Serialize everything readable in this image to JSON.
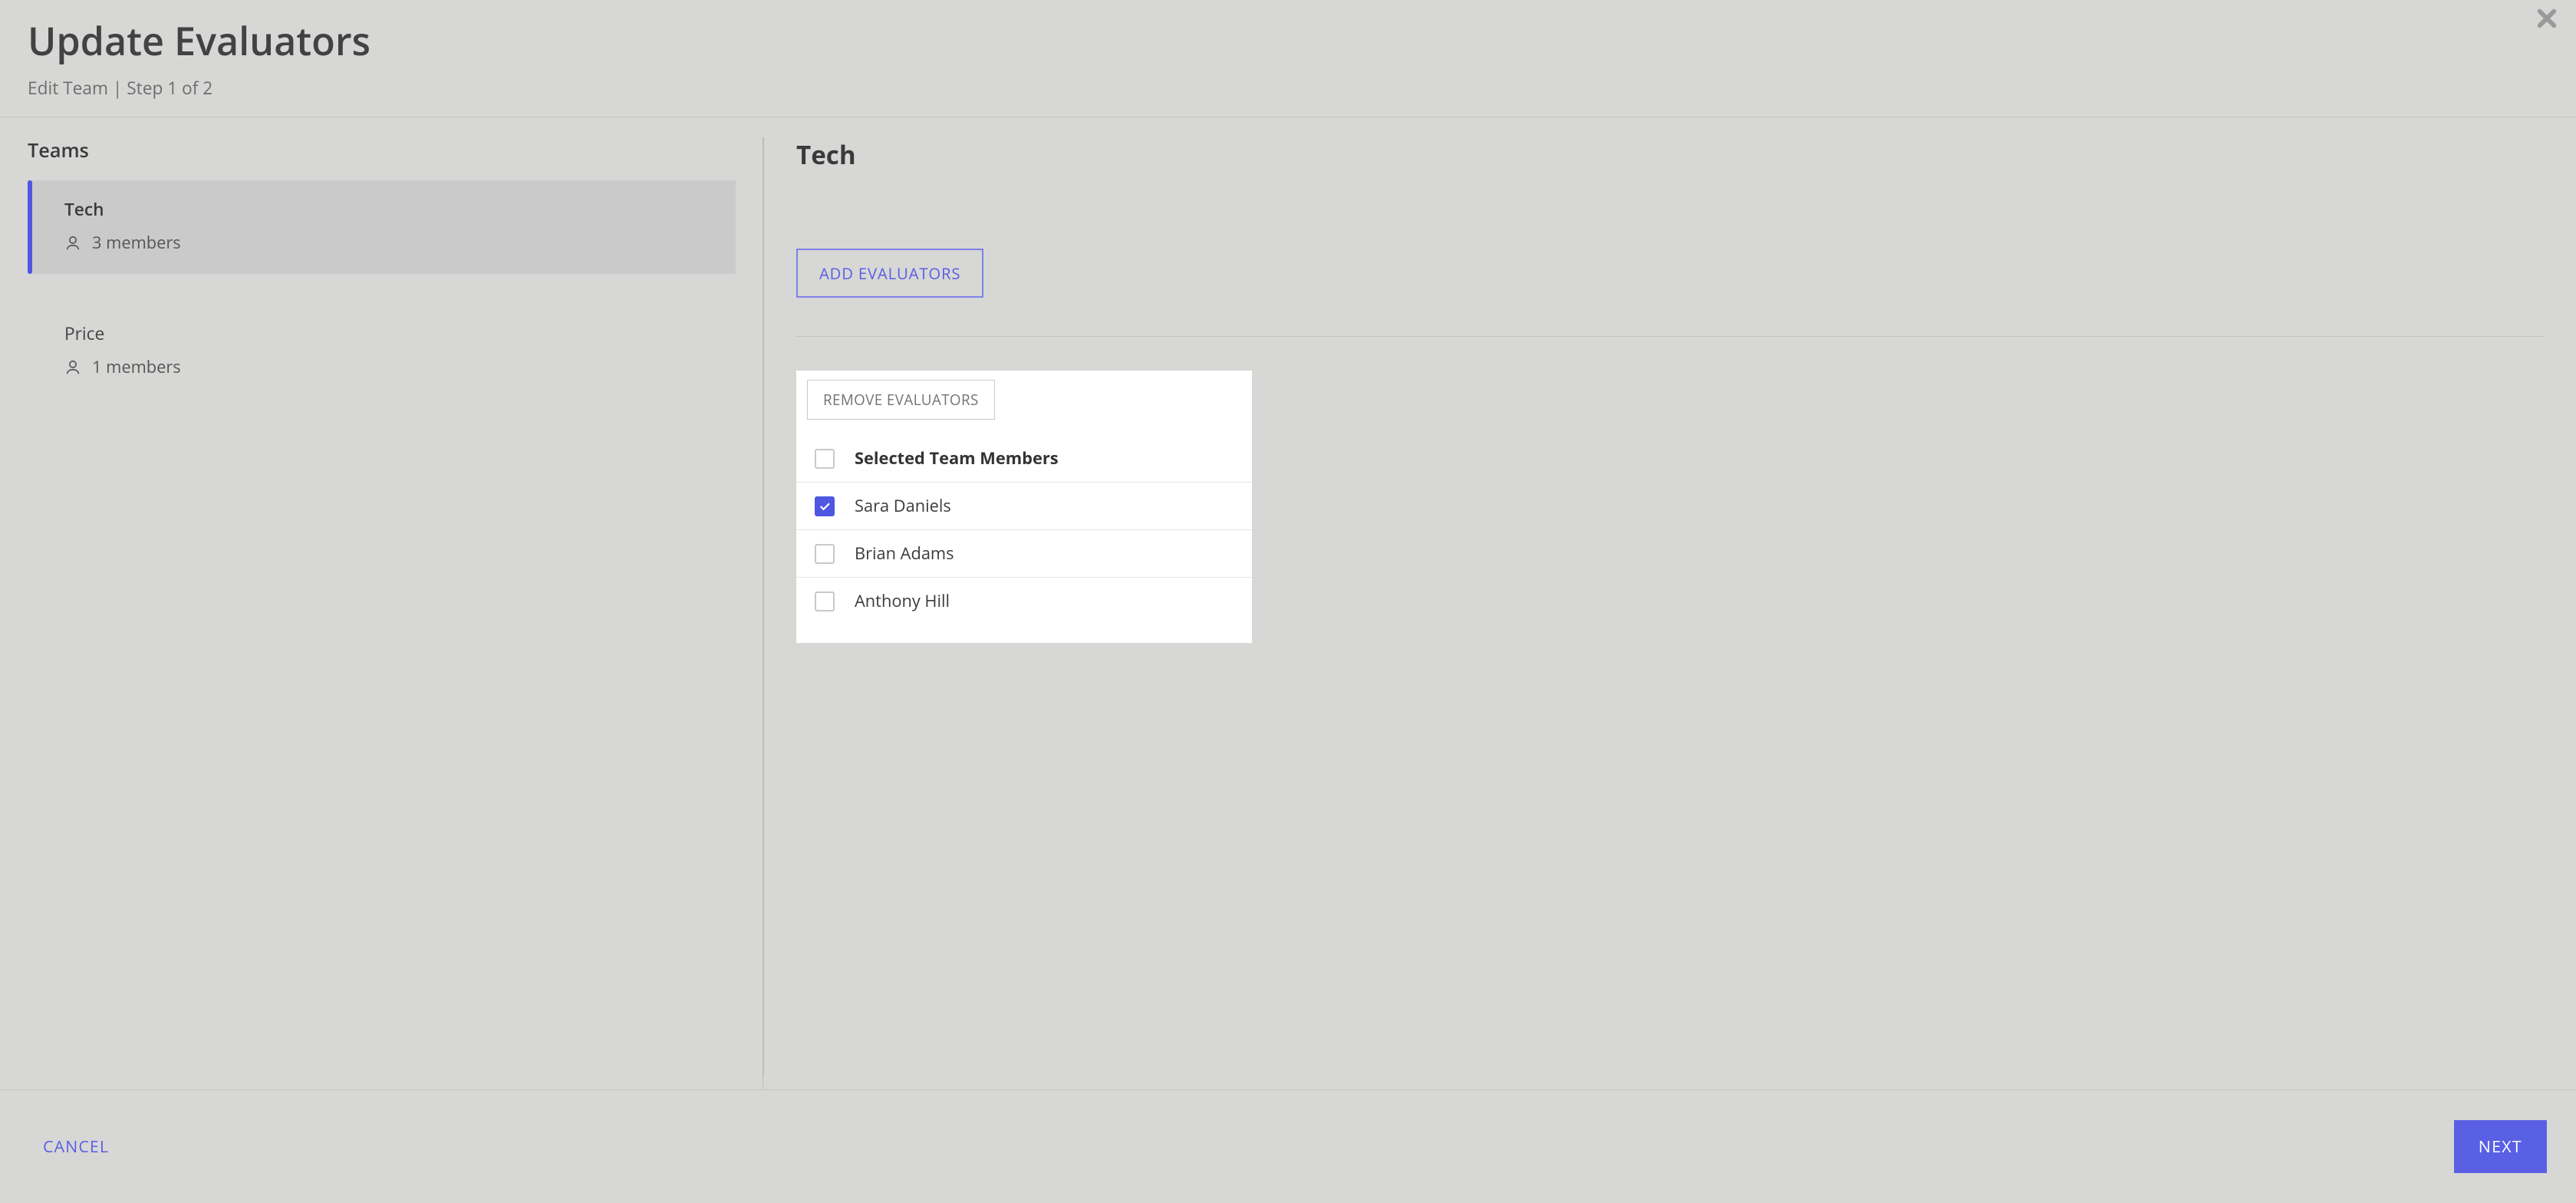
{
  "header": {
    "title": "Update Evaluators",
    "subtitle": "Edit Team | Step 1 of 2"
  },
  "sidebar": {
    "title": "Teams",
    "items": [
      {
        "name": "Tech",
        "members_label": "3 members",
        "active": true
      },
      {
        "name": "Price",
        "members_label": "1 members",
        "active": false
      }
    ]
  },
  "main": {
    "title": "Tech",
    "add_button_label": "ADD EVALUATORS",
    "remove_button_label": "REMOVE EVALUATORS",
    "select_all_label": "Selected Team Members",
    "members": [
      {
        "name": "Sara Daniels",
        "checked": true
      },
      {
        "name": "Brian Adams",
        "checked": false
      },
      {
        "name": "Anthony Hill",
        "checked": false
      }
    ]
  },
  "footer": {
    "cancel_label": "CANCEL",
    "next_label": "NEXT"
  }
}
